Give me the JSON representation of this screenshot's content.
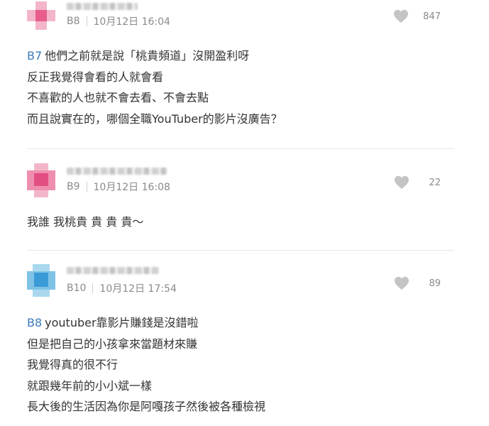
{
  "comments": [
    {
      "floor": "B8",
      "date": "10月12日 16:04",
      "likes": "847",
      "reply_to": "B7",
      "lines": [
        "他們之前就是說「桃貴頻道」沒開盈利呀",
        "反正我覺得會看的人就會看",
        "不喜歡的人也就不會去看、不會去點",
        "而且說實在的，哪個全職YouTuber的影片沒廣告？"
      ]
    },
    {
      "floor": "B9",
      "date": "10月12日 16:08",
      "likes": "22",
      "reply_to": "",
      "lines": [
        "我誰 我桃貴 貴 貴 貴～"
      ]
    },
    {
      "floor": "B10",
      "date": "10月12日 17:54",
      "likes": "89",
      "reply_to": "B8",
      "lines": [
        "youtuber靠影片賺錢是沒錯啦",
        "但是把自己的小孩拿來當題材來賺",
        "我覺得真的很不行",
        "就跟幾年前的小小斌一樣",
        "長大後的生活因為你是阿嘎孩子然後被各種檢視"
      ]
    }
  ],
  "icons": {
    "like": "heart-icon"
  },
  "colors": {
    "reply_link": "#3c7bbd",
    "meta_text": "#8a8a8a",
    "heart": "#c4c4c4"
  }
}
